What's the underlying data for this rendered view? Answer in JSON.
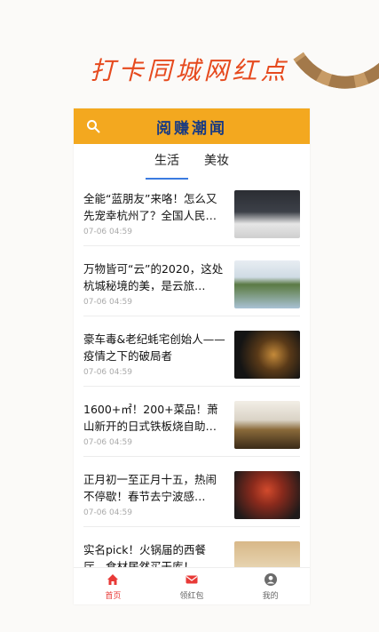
{
  "banner": {
    "title": "打卡同城网红点"
  },
  "header": {
    "title": "阅赚潮闻"
  },
  "tabs": [
    {
      "label": "生活",
      "active": true
    },
    {
      "label": "美妆",
      "active": false
    }
  ],
  "news": [
    {
      "title": "全能“蓝朋友”来咯！怎么又先宠幸杭州了？全国人民…",
      "time": "07-06 04:59",
      "thumb_text": ""
    },
    {
      "title": "万物皆可“云”的2020，这处杭城秘境的美，是云旅…",
      "time": "07-06 04:59",
      "thumb_text": ""
    },
    {
      "title": "豪车毒&老纪蚝宅创始人——疫情之下的破局者",
      "time": "07-06 04:59",
      "thumb_text": ""
    },
    {
      "title": "1600+㎡！200+菜品！萧山新开的日式铁板烧自助…",
      "time": "07-06 04:59",
      "thumb_text": ""
    },
    {
      "title": "正月初一至正月十五，热闹不停歇！春节去宁波感…",
      "time": "07-06 04:59",
      "thumb_text": ""
    },
    {
      "title": "实名pick！火锅届的西餐厅，食材居然买干库！",
      "time": "",
      "thumb_text": ""
    }
  ],
  "bottom_nav": [
    {
      "label": "首页",
      "icon": "home-icon",
      "active": true
    },
    {
      "label": "领红包",
      "icon": "envelope-icon",
      "active": false
    },
    {
      "label": "我的",
      "icon": "profile-icon",
      "active": false
    }
  ],
  "colors": {
    "accent": "#f3a81f",
    "header_text": "#183a83",
    "tab_underline": "#3b7be0",
    "nav_active": "#e83a37",
    "banner_text": "#e64a1e"
  }
}
